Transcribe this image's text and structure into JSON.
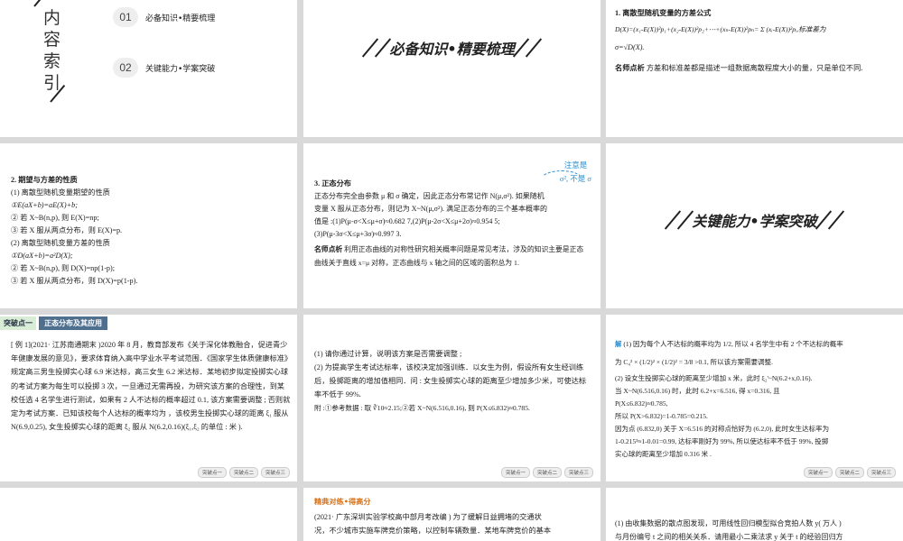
{
  "slide1": {
    "vertical_title_chars": [
      "内",
      "容",
      "索",
      "引"
    ],
    "items": [
      {
        "num": "01",
        "label": "必备知识•精要梳理"
      },
      {
        "num": "02",
        "label": "关键能力•学案突破"
      }
    ]
  },
  "slide2": {
    "banner": "必备知识•精要梳理"
  },
  "slide3": {
    "heading": "1. 离散型随机变量的方差公式",
    "formula": "D(X)=(x₁-E(X))²p₁+(x₂-E(X))²p₂+⋯+(xₙ-E(X))²pₙ= Σ (xᵢ-E(X))²pᵢ,标准差为",
    "formula2": "σ=√D(X).",
    "tip_label": "名师点析",
    "tip": "方差和标准差都是描述一组数据离散程度大小的量，只是单位不同."
  },
  "slide4": {
    "heading": "2. 期望与方差的性质",
    "lines": [
      "(1) 离散型随机变量期望的性质",
      "①E(aX+b)=aE(X)+b;",
      "② 若 X~B(n,p), 则 E(X)=np;",
      "③ 若 X 服从两点分布，则 E(X)=p.",
      "(2) 离散型随机变量方差的性质",
      "①D(aX+b)=a²D(X);",
      "② 若 X~B(n,p), 则 D(X)=np(1-p);",
      "③ 若 X 服从两点分布，则 D(X)=p(1-p)."
    ]
  },
  "slide5": {
    "note_title": "注意是",
    "note_sub": "σ², 不是 σ",
    "heading": "3. 正态分布",
    "lines": [
      "正态分布完全由参数 μ 和 σ 确定，因此正态分布常记作 N(μ,σ²). 如果随机",
      "变量 X 服从正态分布，则记为 X~N(μ,σ²). 满足正态分布的三个基本概率的",
      "值是 :(1)P(μ-σ<X≤μ+σ)≈0.682 7,(2)P(μ-2σ<X≤μ+2σ)≈0.954 5;",
      "(3)P(μ-3σ<X≤μ+3σ)≈0.997 3."
    ],
    "tip_label": "名师点析",
    "tip": "利用正态曲线的对称性研究相关概率问题是常见考法，涉及的知识主要是正态曲线关于直线 x=μ 对称，正态曲线与 x 轴之间的区域的面积总为 1."
  },
  "slide6": {
    "banner": "关键能力•学案突破"
  },
  "slide7": {
    "tag_a": "突破点一",
    "tag_b": "正态分布及其应用",
    "body": "[ 例 1](2021· 江苏南通期末 )2020 年 8 月，教育部发布《关于深化体教融合，促进青少年健康发展的意见》，要求体育纳入高中学业水平考试范围．《国家学生体质健康标准》规定高三男生投掷实心球 6.9 米达标，高三女生 6.2 米达标．某地初步拟定投掷实心球的考试方案为每生可以投掷 3 次，一旦通过无需再投，为研究该方案的合理性，到某校任选 4 名学生进行测试，如果有 2 人不达标的概率超过 0.1, 该方案需要调整 ; 否则就定为考试方案．已知该校每个人达标的概率均为      ，该校男生投掷实心球的距离 ξ₁ 服从 N(6.9,0.25), 女生投掷实心球的距离 ξ₂ 服从 N(6.2,0.16)(ξ₁,ξ₂ 的单位 : 米 ).",
    "nav": [
      "突破点一",
      "突破点二",
      "突破点三"
    ]
  },
  "slide8": {
    "lines": [
      "(1) 请你通过计算，说明该方案是否需要调整 ;",
      "(2) 为提高学生考试达标率，该校决定加强训练．以女生为例，假设所有女生经训练后，投掷距离的增加值相同．问 : 女生投掷实心球的距离至少增加多少米，可使达标率不低于 99%.",
      "附 :①参考数据 : 取 ∛10≈2.15;②若 X~N(6.516,0.16), 则 P(X≤6.832)≈0.785."
    ],
    "nav": [
      "突破点一",
      "突破点二",
      "突破点三"
    ]
  },
  "slide9": {
    "label": "解",
    "lines": [
      "(1) 因为每个人不达标的概率均为 1/2, 所以 4 名学生中有 2 个不达标的概率",
      "为 C₄² × (1/2)² × (1/2)² = 3/8 >0.1, 所以该方案需要调整.",
      "(2) 设女生投掷实心球的距离至少增加 x 米，此时 ξ₂'~N(6.2+x,0.16).",
      "当 X~N(6.516,0.16) 时，此时 6.2+x=6.516, 得 x=0.316, 且",
      "P(X≤6.832)≈0.785,",
      "所以 P(X>6.832)=1-0.785=0.215.",
      "因为点 (6.832,0) 关于 X=6.516 的对称点恰好为 (6.2,0), 此时女生达标率为",
      "1-0.215³≈1-0.01=0.99, 达标率刚好为 99%, 所以使达标率不低于 99%, 投掷",
      "实心球的距离至少增加 0.316 米 ."
    ],
    "nav": [
      "突破点一",
      "突破点二",
      "突破点三"
    ]
  },
  "slide11": {
    "title": "精典对练•得高分",
    "lines": [
      "(2021· 广东深圳实验学校高中部月考改编 ) 为了缓解日益拥堵的交通状",
      "况，不少城市实施车牌竞价策略，以控制车辆数量．某地车牌竞价的基本"
    ]
  },
  "slide12": {
    "lines": [
      "(1) 由收集数据的散点图发现，可用线性回归模型拟合竞拍人数 y( 万人 )",
      "与月份编号 t 之间的相关关系．请用最小二乘法求 y 关于 t 的经验回归方"
    ]
  }
}
